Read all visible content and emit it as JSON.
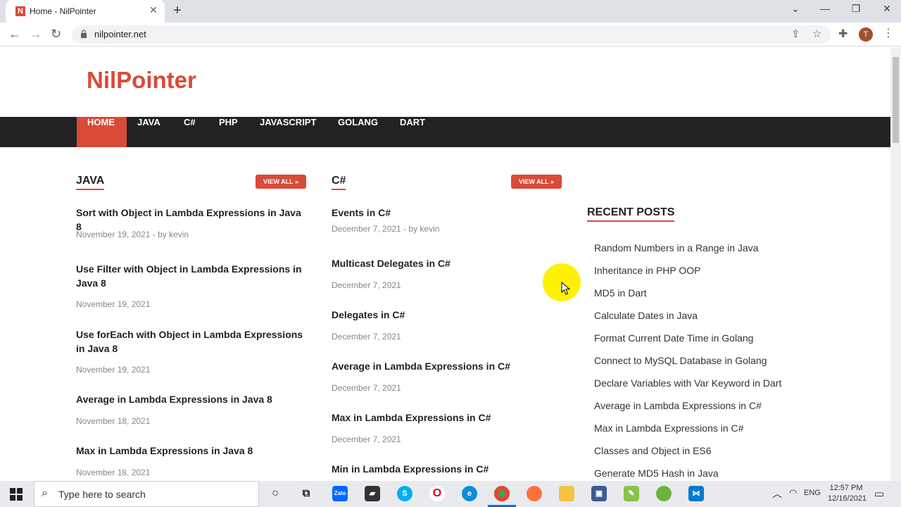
{
  "browser": {
    "tab_title": "Home - NilPointer",
    "tab_favicon": "N",
    "url": "nilpointer.net",
    "profile_initial": "T"
  },
  "site": {
    "logo": "NilPointer",
    "nav": [
      "HOME",
      "JAVA",
      "C#",
      "PHP",
      "JAVASCRIPT",
      "GOLANG",
      "DART"
    ]
  },
  "java_section": {
    "title": "JAVA",
    "view_all": "VIEW ALL »",
    "posts": [
      {
        "title": "Sort with Object in Lambda Expressions in Java 8",
        "meta": "November 19, 2021  -  by kevin"
      },
      {
        "title": "Use Filter with Object in Lambda Expressions in Java 8",
        "meta": "November 19, 2021"
      },
      {
        "title": "Use forEach with Object in Lambda Expressions in Java 8",
        "meta": "November 19, 2021"
      },
      {
        "title": "Average in Lambda Expressions in Java 8",
        "meta": "November 18, 2021"
      },
      {
        "title": "Max in Lambda Expressions in Java 8",
        "meta": "November 18, 2021"
      }
    ]
  },
  "csharp_section": {
    "title": "C#",
    "view_all": "VIEW ALL »",
    "posts": [
      {
        "title": "Events in C#",
        "meta": "December 7, 2021  -  by kevin"
      },
      {
        "title": "Multicast Delegates in C#",
        "meta": "December 7, 2021"
      },
      {
        "title": "Delegates in C#",
        "meta": "December 7, 2021"
      },
      {
        "title": "Average in Lambda Expressions in C#",
        "meta": "December 7, 2021"
      },
      {
        "title": "Max in Lambda Expressions in C#",
        "meta": "December 7, 2021"
      },
      {
        "title": "Min in Lambda Expressions in C#",
        "meta": ""
      }
    ]
  },
  "recent_posts": {
    "title": "RECENT POSTS",
    "items": [
      "Random Numbers in a Range in Java",
      "Inheritance in PHP OOP",
      "MD5 in Dart",
      "Calculate Dates in Java",
      "Format Current Date Time in Golang",
      "Connect to MySQL Database in Golang",
      "Declare Variables with Var Keyword in Dart",
      "Average in Lambda Expressions in C#",
      "Max in Lambda Expressions in C#",
      "Classes and Object in ES6",
      "Generate MD5 Hash in Java"
    ]
  },
  "taskbar": {
    "search_placeholder": "Type here to search",
    "lang": "ENG",
    "time": "12:57 PM",
    "date": "12/16/2021",
    "apps": [
      "task-view",
      "zalo",
      "sticky-notes",
      "skype",
      "opera",
      "edge",
      "chrome",
      "firefox",
      "file-explorer",
      "save-app",
      "notepad-plus",
      "spring-tool",
      "vscode"
    ]
  },
  "colors": {
    "brand": "#d94a38",
    "nav_bg": "#222222"
  }
}
